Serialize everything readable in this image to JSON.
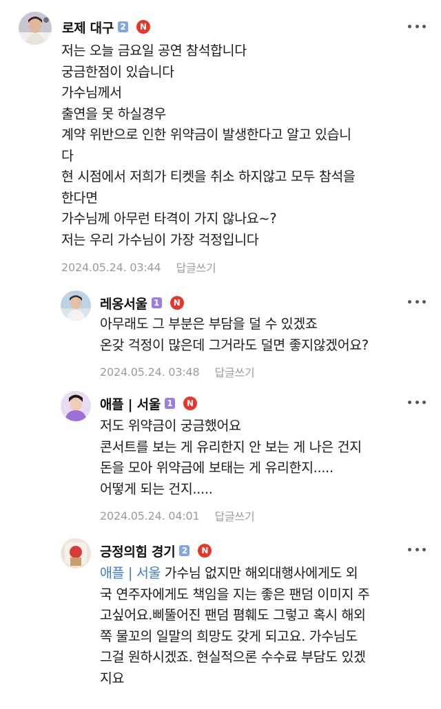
{
  "colors": {
    "grade_badge": "#7fa7e6",
    "grade_badge_purple": "#9a7fe0",
    "n_badge": "#e8362b",
    "meta_text": "#9b9b9b",
    "mention": "#3d7bd8"
  },
  "reply_label": "답글쓰기",
  "comments": [
    {
      "author": "로제 대구",
      "grade": "2",
      "badge": "N",
      "lines": [
        "저는 오늘 금요일 공연 참석합니다",
        "궁금한점이 있습니다",
        "가수님께서",
        "출연을 못 하실경우",
        "계약 위반으로 인한 위약금이 발생한다고 알고 있습니",
        "다",
        "현 시점에서 저희가 티켓을 취소 하지않고 모두 참석을",
        "한다면",
        "가수님께 아무런 타격이 가지 않나요~?",
        "저는 우리 가수님이 가장 걱정입니다"
      ],
      "timestamp": "2024.05.24. 03:44"
    },
    {
      "author": "레옹서울",
      "grade": "1",
      "badge": "N",
      "lines": [
        "아무래도 그 부분은 부담을 덜 수 있겠죠",
        "온갖 걱정이 많은데 그거라도 덜면 좋지않겠어요?"
      ],
      "timestamp": "2024.05.24. 03:48"
    },
    {
      "author": "애플 | 서울",
      "grade": "1",
      "badge": "N",
      "lines": [
        "저도 위약금이 궁금했어요",
        "콘서트를 보는 게 유리한지 안 보는 게 나은 건지",
        "돈을 모아 위약금에 보태는 게 유리한지.....",
        "어떻게 되는 건지....."
      ],
      "timestamp": "2024.05.24. 04:01"
    },
    {
      "author": "긍정의힘 경기",
      "grade": "2",
      "badge": "N",
      "mention": "애플 | 서울",
      "first_line_rest": " 가수님 없지만 해외대행사에게도 외",
      "lines": [
        "국 연주자에게도 책임을 지는 좋은 팬덤 이미지 주",
        "고싶어요.삐뚤어진 팬덤 폄훼도 그렇고 혹시 해외",
        "쪽 물꼬의 일말의 희망도 갖게 되고요. 가수님도",
        "그걸 원하시겠죠. 현실적으론 수수료 부담도 있겠",
        "지요"
      ]
    }
  ]
}
